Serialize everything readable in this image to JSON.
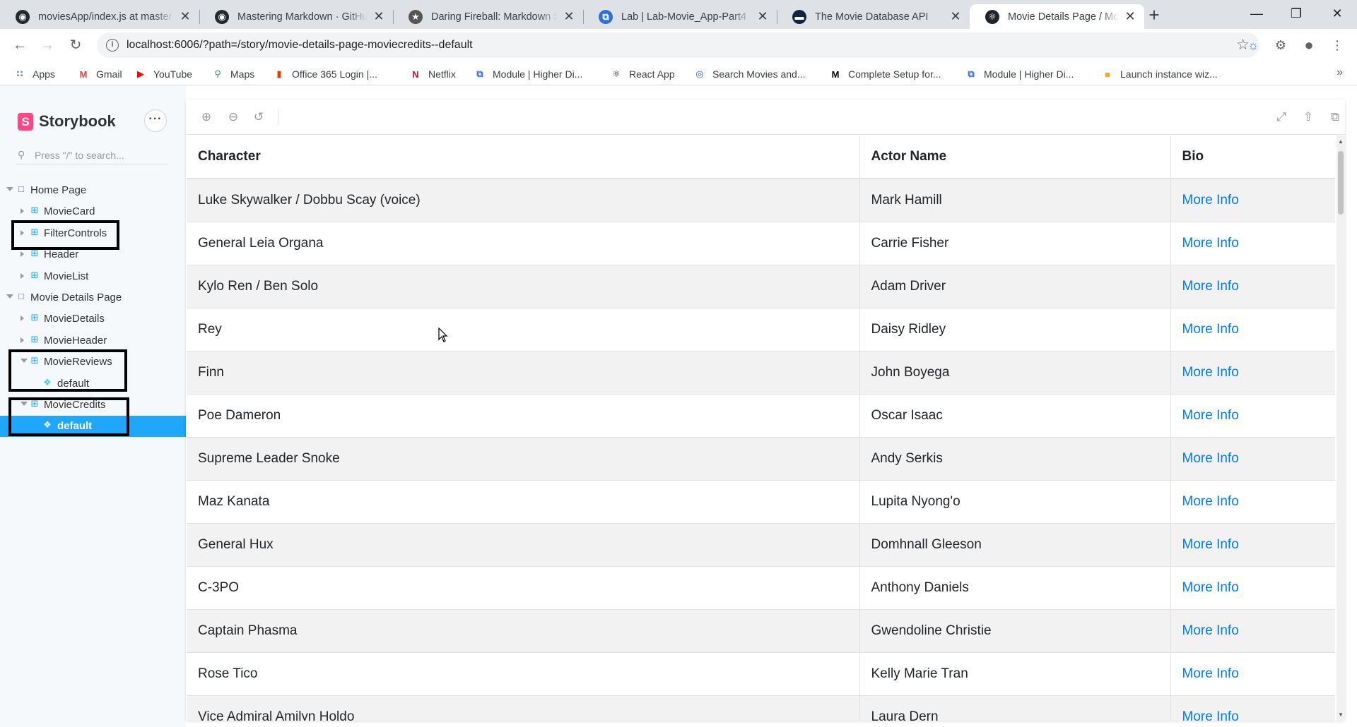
{
  "browser": {
    "tabs": [
      {
        "title": "moviesApp/index.js at master",
        "icon": "github-icon"
      },
      {
        "title": "Mastering Markdown · GitHub",
        "icon": "github-icon"
      },
      {
        "title": "Daring Fireball: Markdown Syntax",
        "icon": "star-icon"
      },
      {
        "title": "Lab | Lab-Movie_App-Part4",
        "icon": "module-icon"
      },
      {
        "title": "The Movie Database API",
        "icon": "tmdb-icon"
      },
      {
        "title": "Movie Details Page / MovieCredits",
        "icon": "react-icon",
        "active": true
      }
    ],
    "url": "localhost:6006/?path=/story/movie-details-page-moviecredits--default",
    "bookmarks": [
      {
        "label": "Apps",
        "icon": "apps-grid-icon"
      },
      {
        "label": "Gmail",
        "icon": "gmail-icon"
      },
      {
        "label": "YouTube",
        "icon": "youtube-icon"
      },
      {
        "label": "Maps",
        "icon": "maps-icon"
      },
      {
        "label": "Office 365 Login |...",
        "icon": "office-icon"
      },
      {
        "label": "Netflix",
        "icon": "netflix-icon"
      },
      {
        "label": "Module | Higher Di...",
        "icon": "module-icon"
      },
      {
        "label": "React App",
        "icon": "react-icon"
      },
      {
        "label": "Search Movies and...",
        "icon": "search-movies-icon"
      },
      {
        "label": "Complete Setup for...",
        "icon": "medium-icon"
      },
      {
        "label": "Module | Higher Di...",
        "icon": "module-icon"
      },
      {
        "label": "Launch instance wiz...",
        "icon": "aws-icon"
      }
    ]
  },
  "storybook": {
    "brand": "Storybook",
    "search_placeholder": "Press \"/\" to search...",
    "tree": [
      {
        "label": "Home Page",
        "type": "folder",
        "level": 0,
        "expanded": true
      },
      {
        "label": "MovieCard",
        "type": "component",
        "level": 1
      },
      {
        "label": "FilterControls",
        "type": "component",
        "level": 1
      },
      {
        "label": "Header",
        "type": "component",
        "level": 1
      },
      {
        "label": "MovieList",
        "type": "component",
        "level": 1
      },
      {
        "label": "Movie Details Page",
        "type": "folder",
        "level": 0,
        "expanded": true
      },
      {
        "label": "MovieDetails",
        "type": "component",
        "level": 1
      },
      {
        "label": "MovieHeader",
        "type": "component",
        "level": 1
      },
      {
        "label": "MovieReviews",
        "type": "component",
        "level": 1,
        "expanded": true
      },
      {
        "label": "default",
        "type": "story",
        "level": 2
      },
      {
        "label": "MovieCredits",
        "type": "component",
        "level": 1,
        "expanded": true
      },
      {
        "label": "default",
        "type": "story",
        "level": 2,
        "selected": true
      }
    ]
  },
  "credits_table": {
    "headers": [
      "Character",
      "Actor Name",
      "Bio"
    ],
    "rows": [
      {
        "character": "Luke Skywalker / Dobbu Scay (voice)",
        "actor": "Mark Hamill",
        "bio": "More Info"
      },
      {
        "character": "General Leia Organa",
        "actor": "Carrie Fisher",
        "bio": "More Info"
      },
      {
        "character": "Kylo Ren / Ben Solo",
        "actor": "Adam Driver",
        "bio": "More Info"
      },
      {
        "character": "Rey",
        "actor": "Daisy Ridley",
        "bio": "More Info"
      },
      {
        "character": "Finn",
        "actor": "John Boyega",
        "bio": "More Info"
      },
      {
        "character": "Poe Dameron",
        "actor": "Oscar Isaac",
        "bio": "More Info"
      },
      {
        "character": "Supreme Leader Snoke",
        "actor": "Andy Serkis",
        "bio": "More Info"
      },
      {
        "character": "Maz Kanata",
        "actor": "Lupita Nyong'o",
        "bio": "More Info"
      },
      {
        "character": "General Hux",
        "actor": "Domhnall Gleeson",
        "bio": "More Info"
      },
      {
        "character": "C-3PO",
        "actor": "Anthony Daniels",
        "bio": "More Info"
      },
      {
        "character": "Captain Phasma",
        "actor": "Gwendoline Christie",
        "bio": "More Info"
      },
      {
        "character": "Rose Tico",
        "actor": "Kelly Marie Tran",
        "bio": "More Info"
      },
      {
        "character": "Vice Admiral Amilyn Holdo",
        "actor": "Laura Dern",
        "bio": "More Info"
      }
    ]
  },
  "colors": {
    "storybook_accent": "#1ea7fd",
    "storybook_brand": "#ff4785",
    "link": "#007bff",
    "annotation_box": "#000000"
  }
}
